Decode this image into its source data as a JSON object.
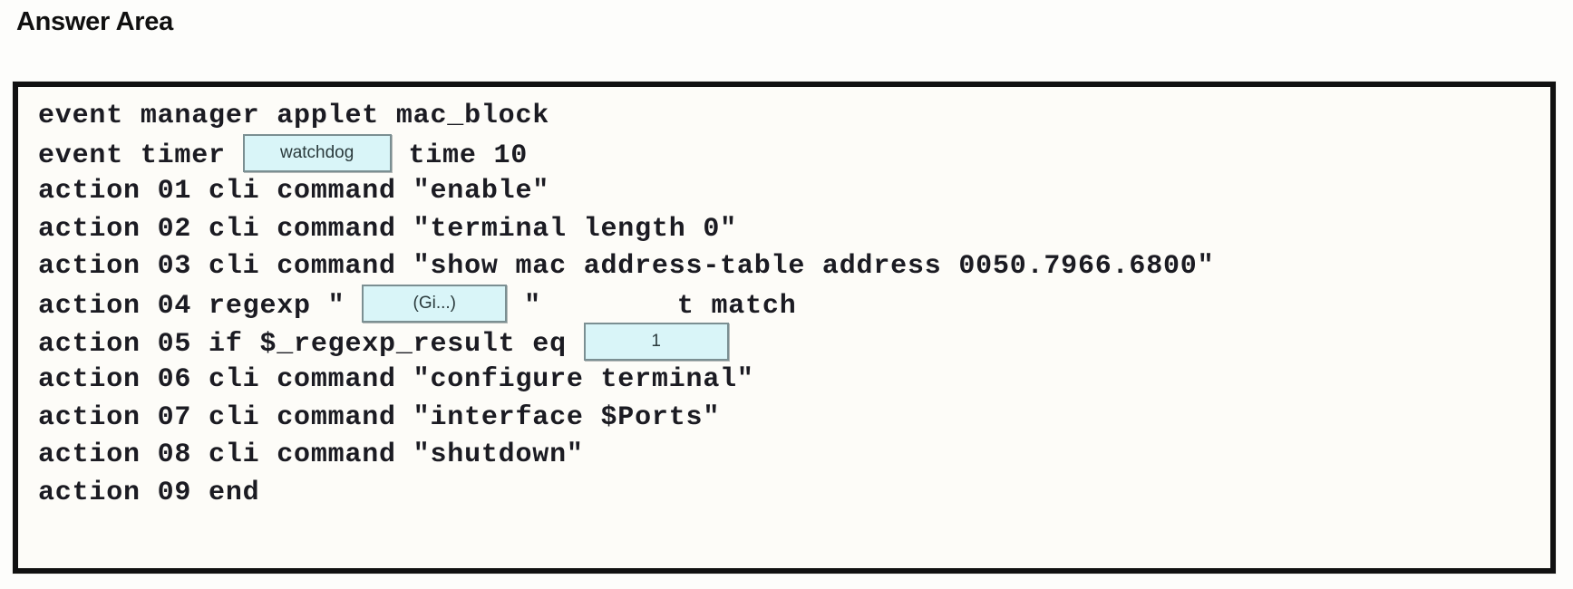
{
  "header": {
    "title": "Answer Area"
  },
  "code_block": {
    "lines": [
      {
        "id": "line-1",
        "segments": [
          {
            "type": "text",
            "value": "event manager applet mac_block"
          }
        ]
      },
      {
        "id": "line-2",
        "segments": [
          {
            "type": "text",
            "value": "event timer "
          },
          {
            "type": "dropdown",
            "name": "dropdown-timer-type",
            "value": "watchdog",
            "style": "dd-watchdog"
          },
          {
            "type": "text",
            "value": " time 10"
          }
        ]
      },
      {
        "id": "line-3",
        "segments": [
          {
            "type": "text",
            "value": "action 01 cli command \"enable\""
          }
        ]
      },
      {
        "id": "line-4",
        "segments": [
          {
            "type": "text",
            "value": "action 02 cli command \"terminal length 0\""
          }
        ]
      },
      {
        "id": "line-5",
        "segments": [
          {
            "type": "text",
            "value": "action 03 cli command \"show mac address-table address 0050.7966.6800\""
          }
        ]
      },
      {
        "id": "line-6",
        "segments": [
          {
            "type": "text",
            "value": "action 04 regexp \" "
          },
          {
            "type": "dropdown",
            "name": "dropdown-regexp-pattern",
            "value": "(Gi...)",
            "style": "dd-regexp"
          },
          {
            "type": "text",
            "value": " \""
          },
          {
            "type": "gap"
          },
          {
            "type": "text",
            "value": "t match"
          }
        ]
      },
      {
        "id": "line-7",
        "segments": [
          {
            "type": "text",
            "value": "action 05 if $_regexp_result eq "
          },
          {
            "type": "dropdown",
            "name": "dropdown-regexp-result-value",
            "value": "1",
            "style": "dd-eq"
          }
        ]
      },
      {
        "id": "line-8",
        "segments": [
          {
            "type": "text",
            "value": "action 06 cli command \"configure terminal\""
          }
        ]
      },
      {
        "id": "line-9",
        "segments": [
          {
            "type": "text",
            "value": "action 07 cli command \"interface $Ports\""
          }
        ]
      },
      {
        "id": "line-10",
        "segments": [
          {
            "type": "text",
            "value": "action 08 cli command \"shutdown\""
          }
        ]
      },
      {
        "id": "line-11",
        "segments": [
          {
            "type": "text",
            "value": "action 09 end"
          }
        ]
      }
    ]
  },
  "colors": {
    "dropdown_fill": "#d9f5f8",
    "dropdown_border": "#7b8f92",
    "panel_border": "#111111",
    "page_background": "#fdfdfb",
    "code_text": "#1b1b22"
  }
}
